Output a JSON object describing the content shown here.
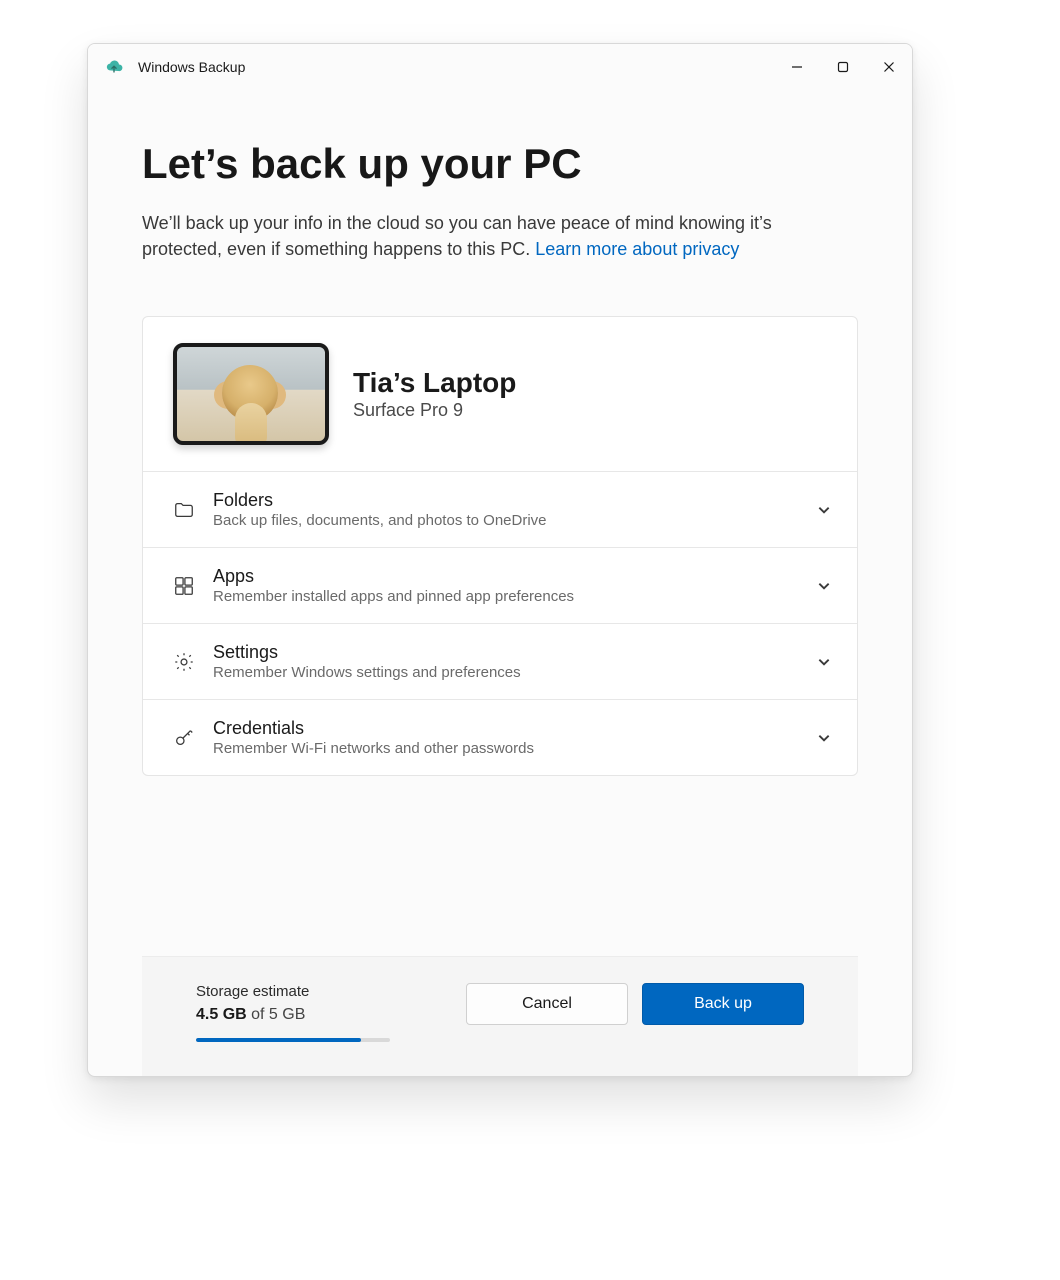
{
  "window": {
    "title": "Windows Backup"
  },
  "header": {
    "title": "Let’s back up your PC",
    "description_pre": "We’ll back up your info in the cloud so you can have peace of mind knowing it’s protected, even if something happens to this PC.  ",
    "privacy_link": "Learn more about privacy"
  },
  "device": {
    "name": "Tia’s Laptop",
    "model": "Surface Pro 9"
  },
  "sections": [
    {
      "id": "folders",
      "icon": "folder-icon",
      "title": "Folders",
      "subtitle": "Back up files, documents, and photos to OneDrive"
    },
    {
      "id": "apps",
      "icon": "apps-icon",
      "title": "Apps",
      "subtitle": "Remember installed apps and pinned app preferences"
    },
    {
      "id": "settings",
      "icon": "gear-icon",
      "title": "Settings",
      "subtitle": "Remember Windows settings and preferences"
    },
    {
      "id": "credentials",
      "icon": "key-icon",
      "title": "Credentials",
      "subtitle": "Remember Wi-Fi networks and other passwords"
    }
  ],
  "footer": {
    "storage_label": "Storage estimate",
    "used": "4.5 GB",
    "of": " of ",
    "total": "5 GB",
    "percent": 85,
    "cancel": "Cancel",
    "backup": "Back up"
  },
  "colors": {
    "accent": "#0067c0"
  }
}
